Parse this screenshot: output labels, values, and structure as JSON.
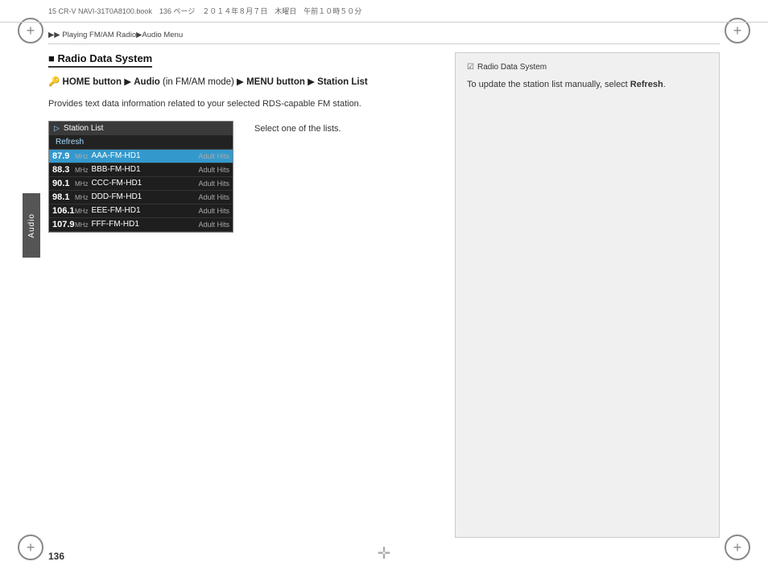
{
  "header": {
    "file_info": "15 CR-V NAVI-31T0A8100.book　136 ページ　２０１４年８月７日　木曜日　午前１０時５０分"
  },
  "breadcrumb": {
    "text": "▶▶ Playing FM/AM Radio▶Audio Menu"
  },
  "section": {
    "heading": "Radio Data System",
    "nav_path_parts": {
      "home_icon": "🔑",
      "home_label": "HOME button",
      "arrow1": " ▶ ",
      "audio_label": "Audio",
      "audio_note": " (in FM/AM mode) ",
      "arrow2": "▶ ",
      "menu_label": "MENU button",
      "arrow3": " ▶ ",
      "station_label": "Station List"
    },
    "description": "Provides text data information related to your selected RDS-capable FM station.",
    "select_text": "Select one of the lists."
  },
  "station_list_ui": {
    "title": "Station List",
    "refresh": "Refresh",
    "stations": [
      {
        "freq": "87.9",
        "unit": "MHz",
        "name": "AAA-FM-HD1",
        "genre": "Adult Hits",
        "selected": true
      },
      {
        "freq": "88.3",
        "unit": "MHz",
        "name": "BBB-FM-HD1",
        "genre": "Adult Hits",
        "selected": false
      },
      {
        "freq": "90.1",
        "unit": "MHz",
        "name": "CCC-FM-HD1",
        "genre": "Adult Hits",
        "selected": false
      },
      {
        "freq": "98.1",
        "unit": "MHz",
        "name": "DDD-FM-HD1",
        "genre": "Adult Hits",
        "selected": false
      },
      {
        "freq": "106.1",
        "unit": "MHz",
        "name": "EEE-FM-HD1",
        "genre": "Adult Hits",
        "selected": false
      },
      {
        "freq": "107.9",
        "unit": "MHz",
        "name": "FFF-FM-HD1",
        "genre": "Adult Hits",
        "selected": false
      }
    ]
  },
  "right_panel": {
    "title": "Radio Data System",
    "text_before": "To update the station list manually, select ",
    "text_bold": "Refresh",
    "text_after": "."
  },
  "sidebar": {
    "label": "Audio"
  },
  "page_number": "136",
  "colors": {
    "accent_blue": "#3399cc",
    "dark_bg": "#1a1a1a",
    "light_bg": "#f0f0f0"
  }
}
